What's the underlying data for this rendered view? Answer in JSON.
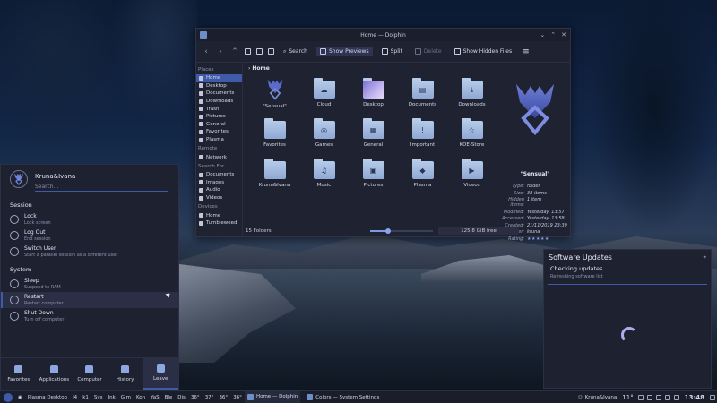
{
  "dolphin": {
    "title": "Home — Dolphin",
    "toolbar": {
      "search": "Search",
      "show_previews": "Show Previews",
      "split": "Split",
      "delete": "Delete",
      "show_hidden": "Show Hidden Files"
    },
    "breadcrumb": "Home",
    "places": {
      "places_header": "Places",
      "items": [
        "Home",
        "Desktop",
        "Documents",
        "Downloads",
        "Trash",
        "Pictures",
        "General",
        "Favorites",
        "Plasma"
      ],
      "remote_header": "Remote",
      "remote_items": [
        "Network"
      ],
      "search_header": "Search For",
      "search_items": [
        "Documents",
        "Images",
        "Audio",
        "Videos"
      ],
      "devices_header": "Devices",
      "device_items": [
        "Home",
        "Tumbleweed"
      ]
    },
    "files": [
      {
        "name": "\"Sensual\"",
        "icon": "emblem"
      },
      {
        "name": "Cloud",
        "icon": "cloud-folder"
      },
      {
        "name": "Desktop",
        "icon": "desktop-folder"
      },
      {
        "name": "Documents",
        "icon": "documents-folder"
      },
      {
        "name": "Downloads",
        "icon": "downloads-folder"
      },
      {
        "name": "Favorites",
        "icon": "folder"
      },
      {
        "name": "Games",
        "icon": "games-folder"
      },
      {
        "name": "General",
        "icon": "general-folder"
      },
      {
        "name": "Important",
        "icon": "important-folder"
      },
      {
        "name": "KDE-Store",
        "icon": "star-folder"
      },
      {
        "name": "Kruna&Ivana",
        "icon": "folder"
      },
      {
        "name": "Music",
        "icon": "music-folder"
      },
      {
        "name": "Pictures",
        "icon": "pictures-folder"
      },
      {
        "name": "Plasma",
        "icon": "plasma-folder"
      },
      {
        "name": "Videos",
        "icon": "videos-folder"
      }
    ],
    "info": {
      "title": "\"Sensual\"",
      "rows": [
        {
          "k": "Type:",
          "v": "folder"
        },
        {
          "k": "Size:",
          "v": "38 items"
        },
        {
          "k": "Hidden items:",
          "v": "1 item"
        },
        {
          "k": "Modified:",
          "v": "Yesterday, 13:57"
        },
        {
          "k": "Accessed:",
          "v": "Yesterday, 13:58"
        },
        {
          "k": "Created:",
          "v": "21/11/2019 23:39"
        },
        {
          "k": "Owner:",
          "v": "kruna"
        },
        {
          "k": "Rating:",
          "v": "★★★★★"
        }
      ]
    },
    "status": {
      "count": "15 Folders",
      "free": "125.8 GiB free",
      "zoom_fraction": 0.28
    }
  },
  "launcher": {
    "user": "Kruna&Ivana",
    "search_placeholder": "Search...",
    "session_header": "Session",
    "session": [
      {
        "title": "Lock",
        "sub": "Lock screen"
      },
      {
        "title": "Log Out",
        "sub": "End session"
      },
      {
        "title": "Switch User",
        "sub": "Start a parallel session as a different user"
      }
    ],
    "system_header": "System",
    "system": [
      {
        "title": "Sleep",
        "sub": "Suspend to RAM"
      },
      {
        "title": "Restart",
        "sub": "Restart computer"
      },
      {
        "title": "Shut Down",
        "sub": "Turn off computer"
      }
    ],
    "tabs": [
      "Favorites",
      "Applications",
      "Computer",
      "History",
      "Leave"
    ]
  },
  "updates": {
    "title": "Software Updates",
    "status": "Checking updates",
    "sub": "Refreshing software list"
  },
  "taskbar": {
    "desktop_label": "Plasma Desktop",
    "pager": [
      "I4",
      "k1"
    ],
    "monitors": [
      "Sys",
      "Ink",
      "Gim",
      "Kon",
      "YaS",
      "Ble",
      "Dis"
    ],
    "temps": [
      "36°",
      "37°",
      "36°",
      "36°"
    ],
    "tasks": [
      "Home — Dolphin",
      "Colors — System Settings"
    ],
    "tray_user": "Kruna&Ivana",
    "weather": "11°",
    "clock": "13:48"
  },
  "colors": {
    "accent": "#3e5aa8",
    "window_bg": "#1f2231",
    "folder": "#a9c0e6"
  }
}
